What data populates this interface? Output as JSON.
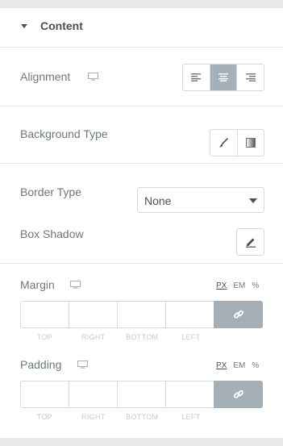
{
  "section": {
    "title": "Content"
  },
  "alignment": {
    "label": "Alignment",
    "options": [
      "left",
      "center",
      "right"
    ],
    "selected": "center"
  },
  "background_type": {
    "label": "Background Type",
    "options": [
      "classic-brush-icon",
      "gradient-icon"
    ]
  },
  "border_type": {
    "label": "Border Type",
    "value": "None"
  },
  "box_shadow": {
    "label": "Box Shadow"
  },
  "margin": {
    "label": "Margin",
    "units": [
      "PX",
      "EM",
      "%"
    ],
    "selected_unit": "PX",
    "fields": [
      "TOP",
      "RIGHT",
      "BOTTOM",
      "LEFT"
    ]
  },
  "padding": {
    "label": "Padding",
    "units": [
      "PX",
      "EM",
      "%"
    ],
    "selected_unit": "PX",
    "fields": [
      "TOP",
      "RIGHT",
      "BOTTOM",
      "LEFT"
    ]
  },
  "colors": {
    "active_segment": "#a4afb7",
    "border": "#d5dadf",
    "text": "#6d7882",
    "heading": "#495157"
  }
}
